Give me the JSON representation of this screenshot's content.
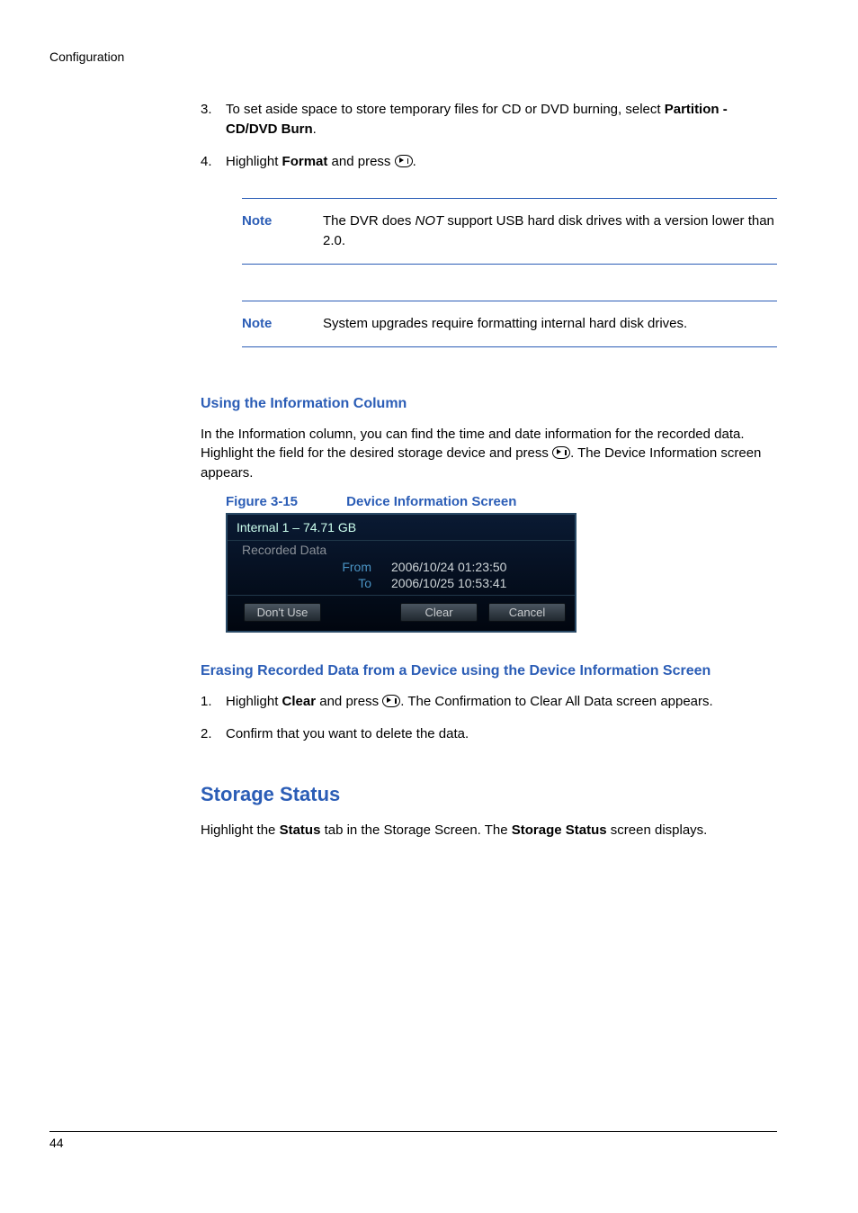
{
  "header": {
    "running": "Configuration"
  },
  "step3": {
    "num": "3.",
    "text_pre": "To set aside space to store temporary files for CD or DVD burning, select ",
    "bold1": "Partition - CD/DVD Burn",
    "text_post": "."
  },
  "step4": {
    "num": "4.",
    "text_pre": "Highlight ",
    "bold1": "Format",
    "text_mid": " and press ",
    "text_post": "."
  },
  "note1": {
    "label": "Note",
    "pre": "The DVR does ",
    "em": "NOT",
    "post": " support USB hard disk drives with a version lower than 2.0."
  },
  "note2": {
    "label": "Note",
    "text": "System upgrades require formatting internal hard disk drives."
  },
  "info_column": {
    "heading": "Using the Information Column",
    "p_pre": "In the Information column, you can find the time and date information for the recorded data. Highlight the field for the desired storage device and press ",
    "p_post": ". The Device Information screen appears."
  },
  "figure": {
    "num": "Figure 3-15",
    "title": "Device Information Screen"
  },
  "device_info": {
    "title": "Internal 1 – 74.71 GB",
    "section": "Recorded Data",
    "rows": [
      {
        "label": "From",
        "val": "2006/10/24  01:23:50"
      },
      {
        "label": "To",
        "val": "2006/10/25  10:53:41"
      }
    ],
    "btn_dont_use": "Don't Use",
    "btn_clear": "Clear",
    "btn_cancel": "Cancel"
  },
  "erase_section": {
    "heading": "Erasing Recorded Data from a Device using the Device Information Screen",
    "s1_num": "1.",
    "s1_pre": "Highlight ",
    "s1_bold": "Clear",
    "s1_mid": " and press ",
    "s1_post": ". The Confirmation to Clear All Data screen appears.",
    "s2_num": "2.",
    "s2_text": "Confirm that you want to delete the data."
  },
  "storage_status": {
    "heading": "Storage Status",
    "p_pre": "Highlight the ",
    "p_bold1": "Status",
    "p_mid": " tab in the Storage Screen. The ",
    "p_bold2": "Storage Status",
    "p_post": " screen displays."
  },
  "footer": {
    "page": "44"
  }
}
